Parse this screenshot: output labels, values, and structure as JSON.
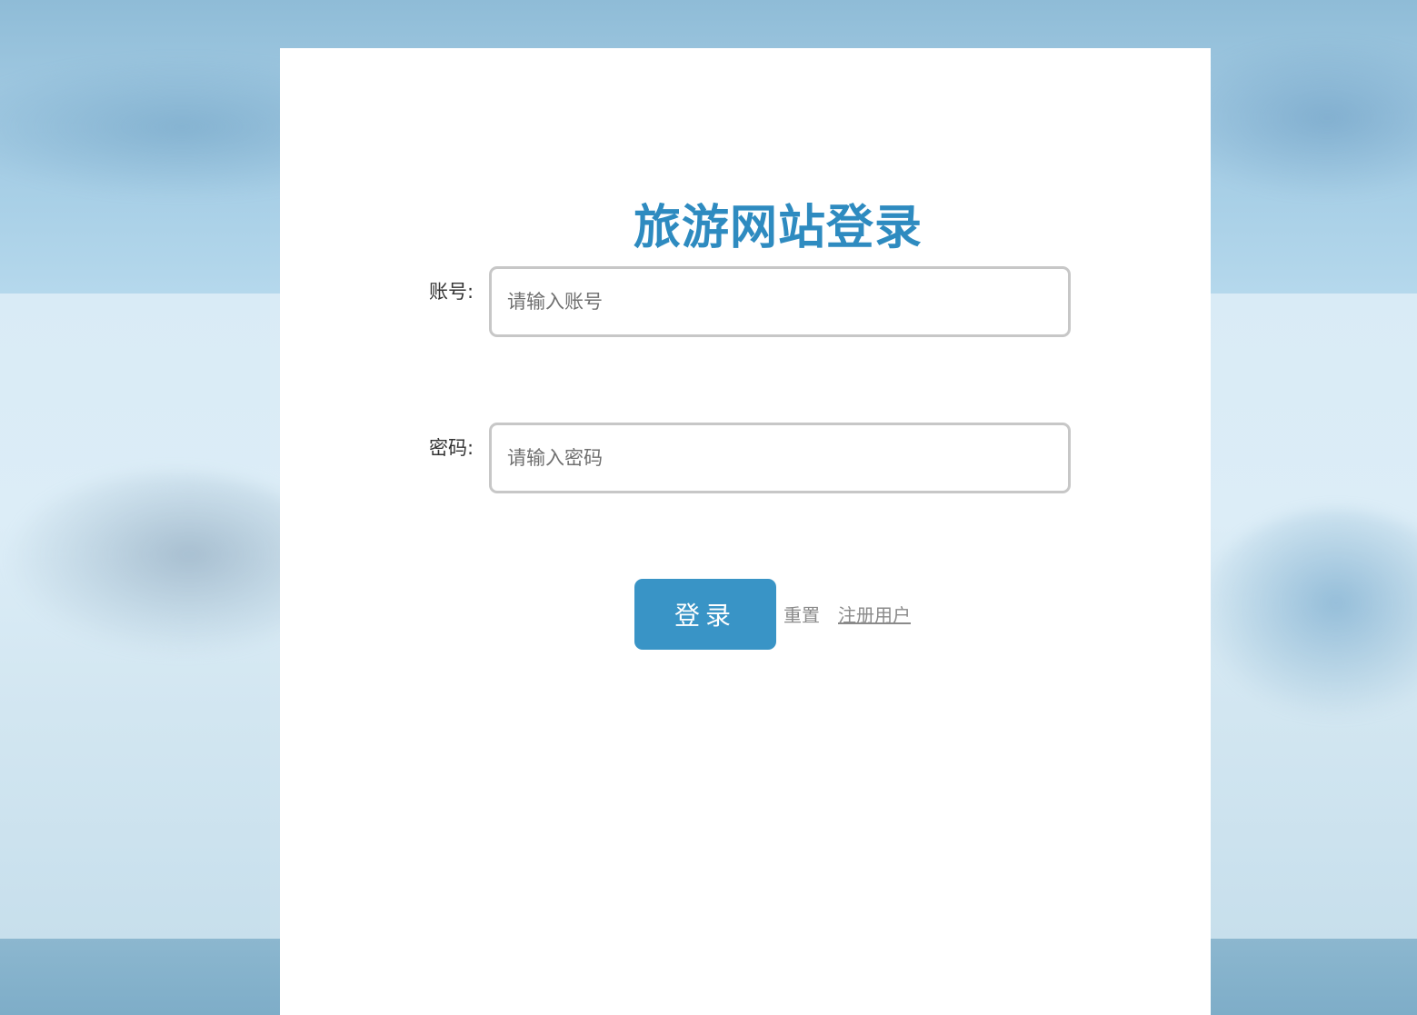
{
  "page": {
    "title": "旅游网站登录"
  },
  "form": {
    "account": {
      "label": "账号:",
      "placeholder": "请输入账号",
      "value": ""
    },
    "password": {
      "label": "密码:",
      "placeholder": "请输入密码",
      "value": ""
    }
  },
  "actions": {
    "login_label": "登录",
    "reset_label": "重置",
    "register_label": "注册用户"
  },
  "colors": {
    "accent": "#2e8bc0",
    "button": "#3994c6",
    "link": "#8a8a8a",
    "input_border": "#c7c7c7"
  }
}
